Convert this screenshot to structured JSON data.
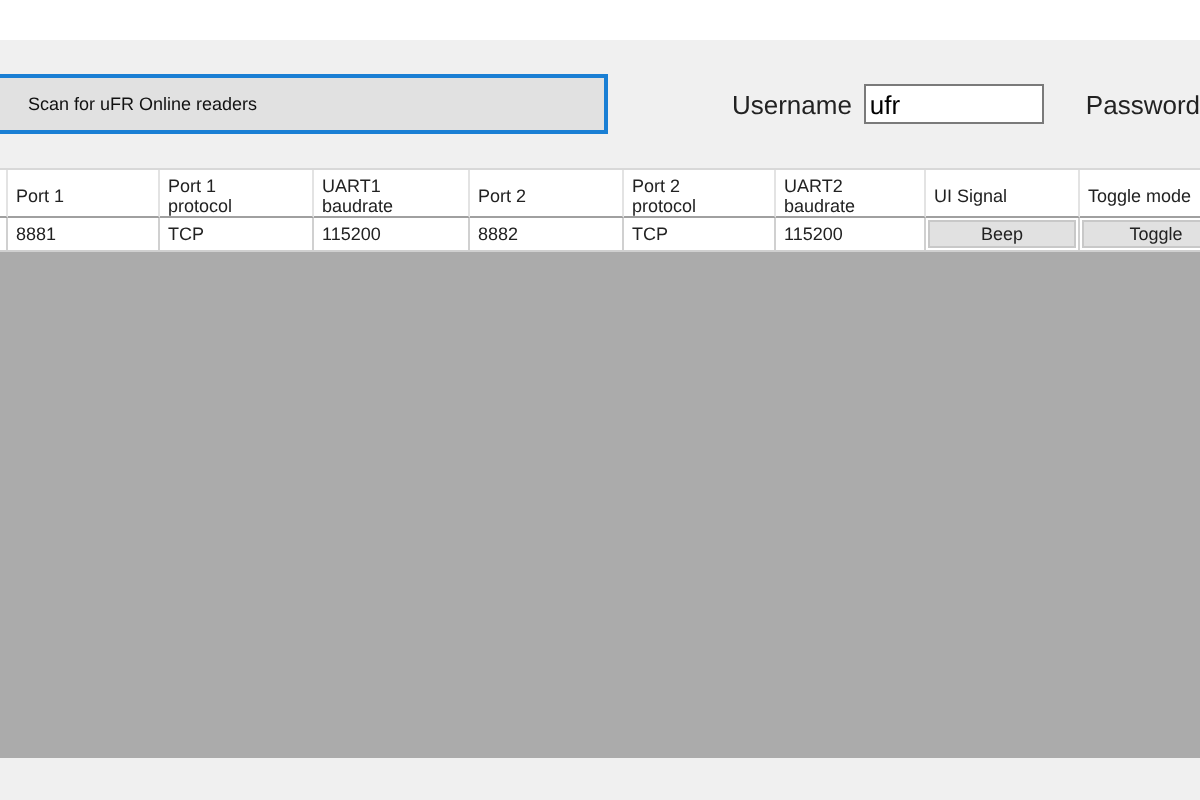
{
  "toolbar": {
    "scan_button": "Scan for uFR Online readers",
    "username_label": "Username",
    "username_value": "ufr",
    "password_label": "Password"
  },
  "table": {
    "columns": [
      {
        "label": "Port 1",
        "kind": "text"
      },
      {
        "label": "Port 1\nprotocol",
        "kind": "text"
      },
      {
        "label": "UART1\nbaudrate",
        "kind": "text"
      },
      {
        "label": "Port 2",
        "kind": "text"
      },
      {
        "label": "Port 2\nprotocol",
        "kind": "text"
      },
      {
        "label": "UART2\nbaudrate",
        "kind": "text"
      },
      {
        "label": "UI Signal",
        "kind": "button"
      },
      {
        "label": "Toggle mode",
        "kind": "button"
      }
    ],
    "rows": [
      [
        "8881",
        "TCP",
        "115200",
        "8882",
        "TCP",
        "115200",
        "Beep",
        "Toggle"
      ]
    ]
  }
}
